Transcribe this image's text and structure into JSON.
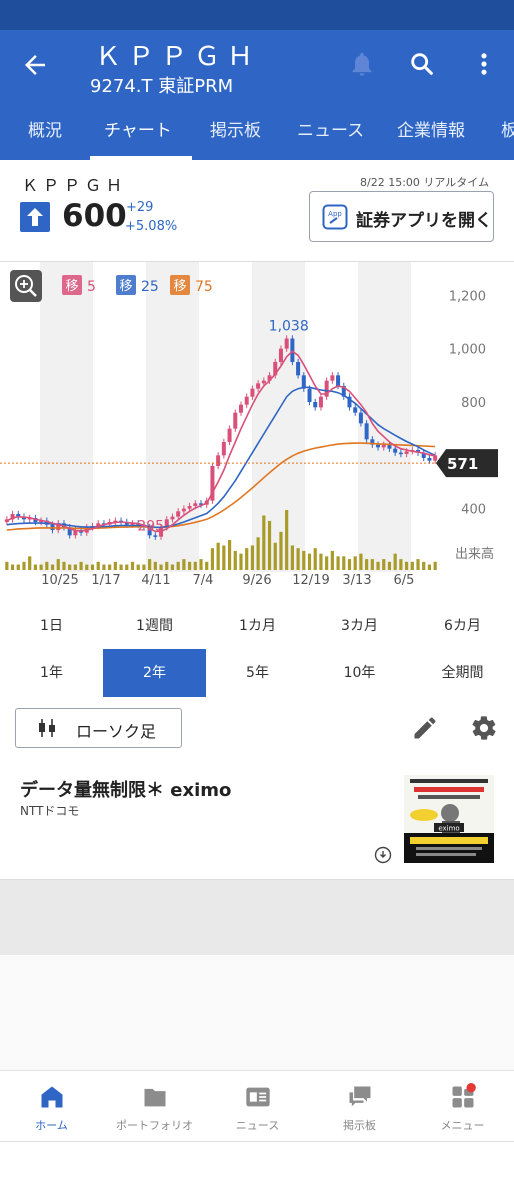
{
  "header": {
    "title": "ＫＰＰＧＨ",
    "subtitle": "9274.T 東証PRM",
    "tabs": [
      {
        "label": "概況"
      },
      {
        "label": "チャート"
      },
      {
        "label": "掲示板"
      },
      {
        "label": "ニュース"
      },
      {
        "label": "企業情報"
      },
      {
        "label": "板"
      }
    ],
    "active_tab": "チャート"
  },
  "quote": {
    "name": "ＫＰＰＧＨ",
    "time": "8/22 15:00 リアルタイム",
    "price": "600",
    "change": "+29",
    "change_pct": "+5.08%",
    "open_app_label": "証券アプリを開く"
  },
  "chart_data": {
    "type": "candlestick",
    "ma_labels": [
      {
        "prefix": "移",
        "value": "5",
        "color": "#d9507a"
      },
      {
        "prefix": "移",
        "value": "25",
        "color": "#2f66c5"
      },
      {
        "prefix": "移",
        "value": "75",
        "color": "#e0761f"
      }
    ],
    "y_ticks": [
      "1,200",
      "1,000",
      "800",
      "400"
    ],
    "volume_label": "出来高",
    "x_ticks": [
      "10/25",
      "1/17",
      "4/11",
      "7/4",
      "9/26",
      "12/19",
      "3/13",
      "6/5"
    ],
    "annotations": {
      "high": "1,038",
      "low": "295"
    },
    "current_price_label": "571",
    "ylim": [
      200,
      1250
    ],
    "close": [
      360,
      380,
      370,
      360,
      365,
      350,
      355,
      340,
      320,
      345,
      330,
      300,
      320,
      310,
      330,
      335,
      345,
      340,
      350,
      355,
      350,
      340,
      345,
      340,
      330,
      300,
      295,
      330,
      360,
      370,
      390,
      400,
      410,
      420,
      415,
      430,
      560,
      600,
      650,
      700,
      760,
      790,
      820,
      850,
      870,
      880,
      900,
      950,
      1000,
      1038,
      950,
      900,
      850,
      800,
      780,
      820,
      880,
      900,
      860,
      820,
      780,
      760,
      720,
      660,
      640,
      630,
      640,
      625,
      610,
      605,
      615,
      620,
      610,
      590,
      580,
      600
    ],
    "ma5": [
      355,
      365,
      370,
      368,
      366,
      360,
      356,
      352,
      345,
      340,
      335,
      325,
      318,
      316,
      320,
      325,
      333,
      340,
      345,
      348,
      350,
      348,
      346,
      344,
      338,
      325,
      315,
      315,
      325,
      340,
      358,
      375,
      390,
      402,
      412,
      420,
      460,
      500,
      545,
      600,
      650,
      700,
      745,
      790,
      830,
      860,
      880,
      905,
      935,
      970,
      990,
      975,
      940,
      900,
      860,
      830,
      830,
      850,
      860,
      855,
      840,
      815,
      790,
      760,
      720,
      690,
      670,
      650,
      635,
      625,
      620,
      615,
      612,
      608,
      602,
      598
    ],
    "ma25": [
      340,
      342,
      344,
      345,
      346,
      346,
      346,
      345,
      343,
      342,
      340,
      337,
      334,
      332,
      331,
      331,
      332,
      333,
      334,
      336,
      337,
      337,
      337,
      337,
      336,
      333,
      330,
      330,
      333,
      337,
      343,
      350,
      358,
      366,
      374,
      382,
      400,
      420,
      445,
      475,
      505,
      540,
      575,
      610,
      645,
      680,
      715,
      750,
      785,
      820,
      840,
      850,
      855,
      855,
      850,
      845,
      842,
      840,
      835,
      825,
      810,
      795,
      775,
      755,
      735,
      715,
      700,
      688,
      675,
      663,
      652,
      642,
      632,
      620,
      610,
      600
    ],
    "ma75": [
      320,
      322,
      324,
      325,
      326,
      327,
      328,
      328,
      328,
      328,
      328,
      327,
      326,
      326,
      326,
      326,
      327,
      328,
      329,
      330,
      331,
      331,
      332,
      332,
      332,
      331,
      330,
      330,
      331,
      333,
      336,
      340,
      344,
      349,
      354,
      360,
      370,
      382,
      395,
      410,
      425,
      442,
      460,
      478,
      497,
      516,
      535,
      553,
      570,
      585,
      598,
      608,
      616,
      622,
      627,
      631,
      635,
      639,
      642,
      644,
      645,
      646,
      646,
      645,
      644,
      643,
      642,
      641,
      640,
      639,
      638,
      637,
      636,
      635,
      634,
      633
    ],
    "volume": [
      3,
      2,
      2,
      3,
      5,
      2,
      2,
      3,
      2,
      4,
      3,
      2,
      2,
      3,
      2,
      2,
      3,
      2,
      2,
      3,
      2,
      2,
      3,
      2,
      2,
      4,
      3,
      2,
      3,
      2,
      3,
      4,
      3,
      3,
      4,
      3,
      8,
      10,
      9,
      11,
      7,
      6,
      8,
      9,
      12,
      20,
      18,
      10,
      14,
      22,
      9,
      8,
      7,
      6,
      8,
      6,
      5,
      7,
      5,
      5,
      4,
      5,
      6,
      4,
      4,
      3,
      4,
      3,
      6,
      4,
      3,
      3,
      4,
      3,
      2,
      3
    ]
  },
  "periods": {
    "row1": [
      "1日",
      "1週間",
      "1カ月",
      "3カ月",
      "6カ月"
    ],
    "row2": [
      "1年",
      "2年",
      "5年",
      "10年",
      "全期間"
    ],
    "active": "2年"
  },
  "chart_controls": {
    "chart_type_label": "ローソク足"
  },
  "ad": {
    "title": "データ量無制限＊ eximo",
    "sponsor": "NTTドコモ",
    "image_text": "eximo"
  },
  "bottom_nav": [
    {
      "label": "ホーム",
      "icon": "home-icon"
    },
    {
      "label": "ポートフォリオ",
      "icon": "folder-icon"
    },
    {
      "label": "ニュース",
      "icon": "news-icon"
    },
    {
      "label": "掲示板",
      "icon": "chat-icon"
    },
    {
      "label": "メニュー",
      "icon": "menu-grid-icon"
    }
  ],
  "colors": {
    "primary": "#2f66c5",
    "ma5": "#d9507a",
    "ma25": "#2f66c5",
    "ma75": "#e0761f",
    "volume": "#a89b2a",
    "up": "#d9507a",
    "down": "#2f66c5"
  }
}
